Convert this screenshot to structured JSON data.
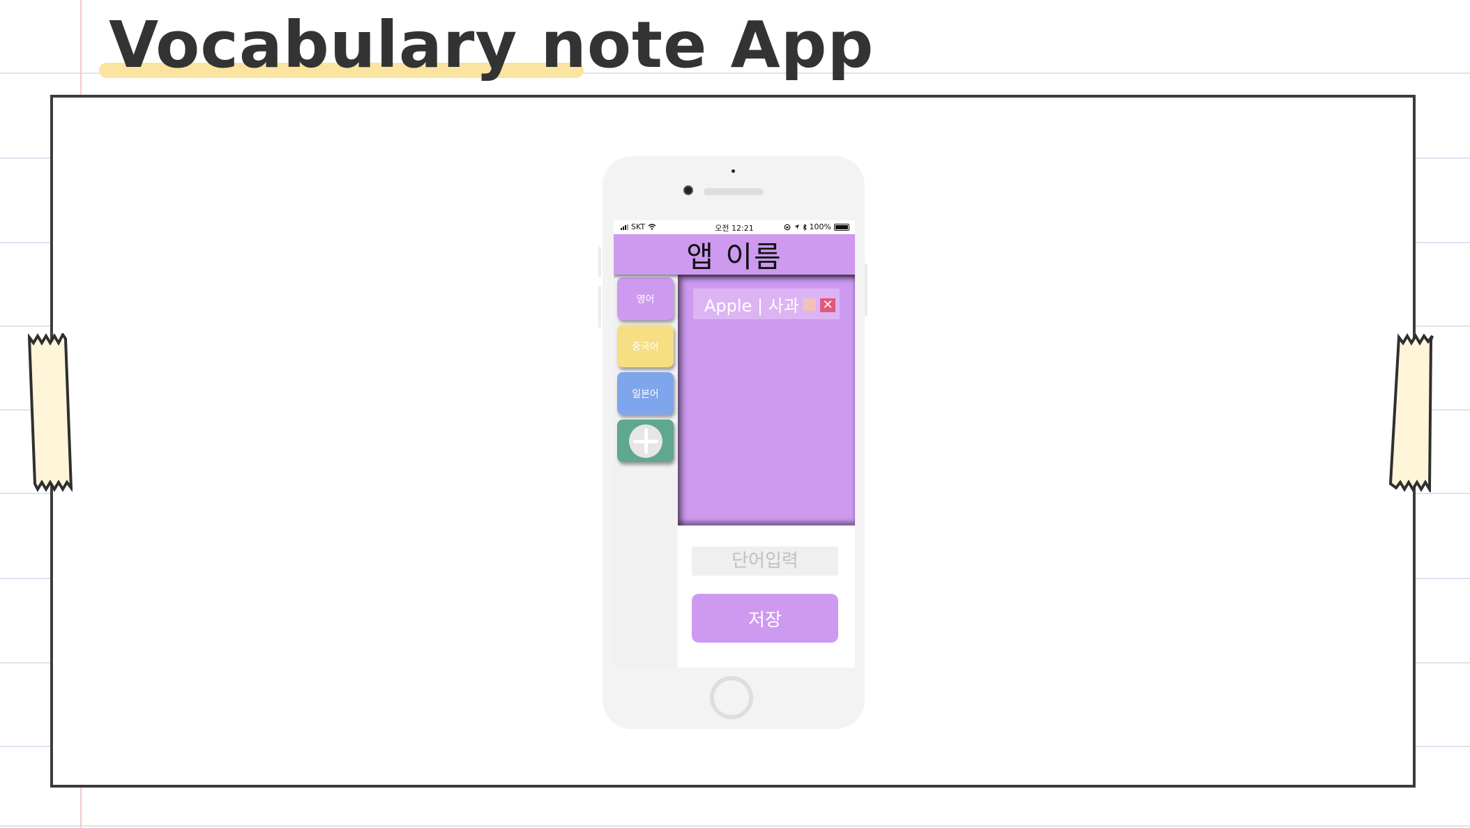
{
  "slide": {
    "title": "Vocabulary note App"
  },
  "colors": {
    "accent_purple": "#cd9af0",
    "english_button": "#cd9af0",
    "chinese_button": "#f6de83",
    "japanese_button": "#7fa6ec",
    "add_button": "#5fa78d",
    "delete_button": "#e05a7a",
    "title_highlight": "#fbe3a0",
    "tape_fill": "#fff5d8"
  },
  "status_bar": {
    "carrier": "SKT",
    "time": "오전 12:21",
    "battery": "100%",
    "icons": [
      "signal-icon",
      "wifi-icon",
      "lock-rotation-icon",
      "location-icon",
      "bluetooth-icon",
      "battery-icon"
    ]
  },
  "app": {
    "title": "앱 이름",
    "languages": [
      {
        "label": "영어"
      },
      {
        "label": "중국어"
      },
      {
        "label": "일본어"
      }
    ],
    "add_icon": "plus-icon",
    "words": [
      {
        "text": "Apple | 사과"
      }
    ],
    "input": {
      "placeholder": "단어입력",
      "value": ""
    },
    "save_label": "저장",
    "delete_glyph": "✕"
  }
}
